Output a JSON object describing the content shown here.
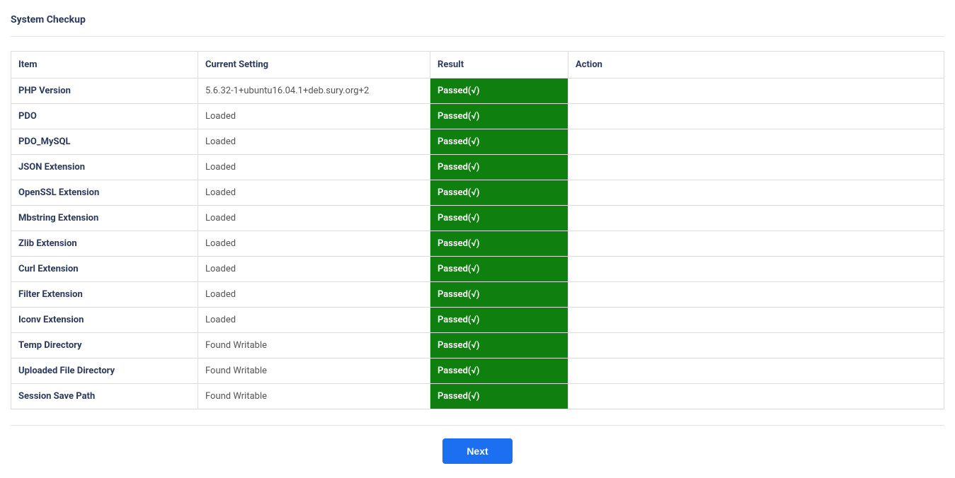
{
  "title": "System Checkup",
  "columns": {
    "item": "Item",
    "setting": "Current Setting",
    "result": "Result",
    "action": "Action"
  },
  "rows": [
    {
      "item": "PHP Version",
      "setting": "5.6.32-1+ubuntu16.04.1+deb.sury.org+2",
      "result": "Passed(√)",
      "action": ""
    },
    {
      "item": "PDO",
      "setting": "Loaded",
      "result": "Passed(√)",
      "action": ""
    },
    {
      "item": "PDO_MySQL",
      "setting": "Loaded",
      "result": "Passed(√)",
      "action": ""
    },
    {
      "item": "JSON Extension",
      "setting": "Loaded",
      "result": "Passed(√)",
      "action": ""
    },
    {
      "item": "OpenSSL Extension",
      "setting": "Loaded",
      "result": "Passed(√)",
      "action": ""
    },
    {
      "item": "Mbstring Extension",
      "setting": "Loaded",
      "result": "Passed(√)",
      "action": ""
    },
    {
      "item": "Zlib Extension",
      "setting": "Loaded",
      "result": "Passed(√)",
      "action": ""
    },
    {
      "item": "Curl Extension",
      "setting": "Loaded",
      "result": "Passed(√)",
      "action": ""
    },
    {
      "item": "Filter Extension",
      "setting": "Loaded",
      "result": "Passed(√)",
      "action": ""
    },
    {
      "item": "Iconv Extension",
      "setting": "Loaded",
      "result": "Passed(√)",
      "action": ""
    },
    {
      "item": "Temp Directory",
      "setting": "Found Writable",
      "result": "Passed(√)",
      "action": ""
    },
    {
      "item": "Uploaded File Directory",
      "setting": "Found Writable",
      "result": "Passed(√)",
      "action": ""
    },
    {
      "item": "Session Save Path",
      "setting": "Found Writable",
      "result": "Passed(√)",
      "action": ""
    }
  ],
  "next_button": "Next"
}
